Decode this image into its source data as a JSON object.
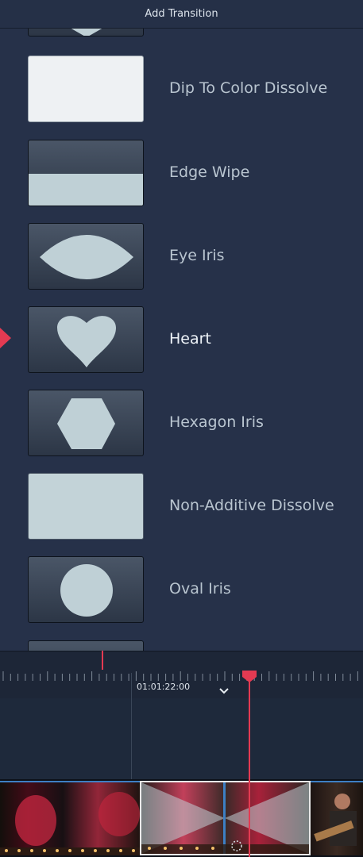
{
  "header": {
    "title": "Add Transition"
  },
  "transitions": [
    {
      "label": "Dip To Color Dissolve",
      "icon": "solid-white-thumb",
      "selected": false
    },
    {
      "label": "Edge Wipe",
      "icon": "edge-wipe-thumb",
      "selected": false
    },
    {
      "label": "Eye Iris",
      "icon": "eye-iris-thumb",
      "selected": false
    },
    {
      "label": "Heart",
      "icon": "heart-thumb",
      "selected": true
    },
    {
      "label": "Hexagon Iris",
      "icon": "hexagon-thumb",
      "selected": false
    },
    {
      "label": "Non-Additive Dissolve",
      "icon": "solid-light-thumb",
      "selected": false
    },
    {
      "label": "Oval Iris",
      "icon": "circle-thumb",
      "selected": false
    }
  ],
  "timeline": {
    "timecode": "01:01:22:00"
  },
  "colors": {
    "accent": "#e43a52",
    "thumb_shape": "#bfd0d6",
    "panel": "#263149"
  }
}
